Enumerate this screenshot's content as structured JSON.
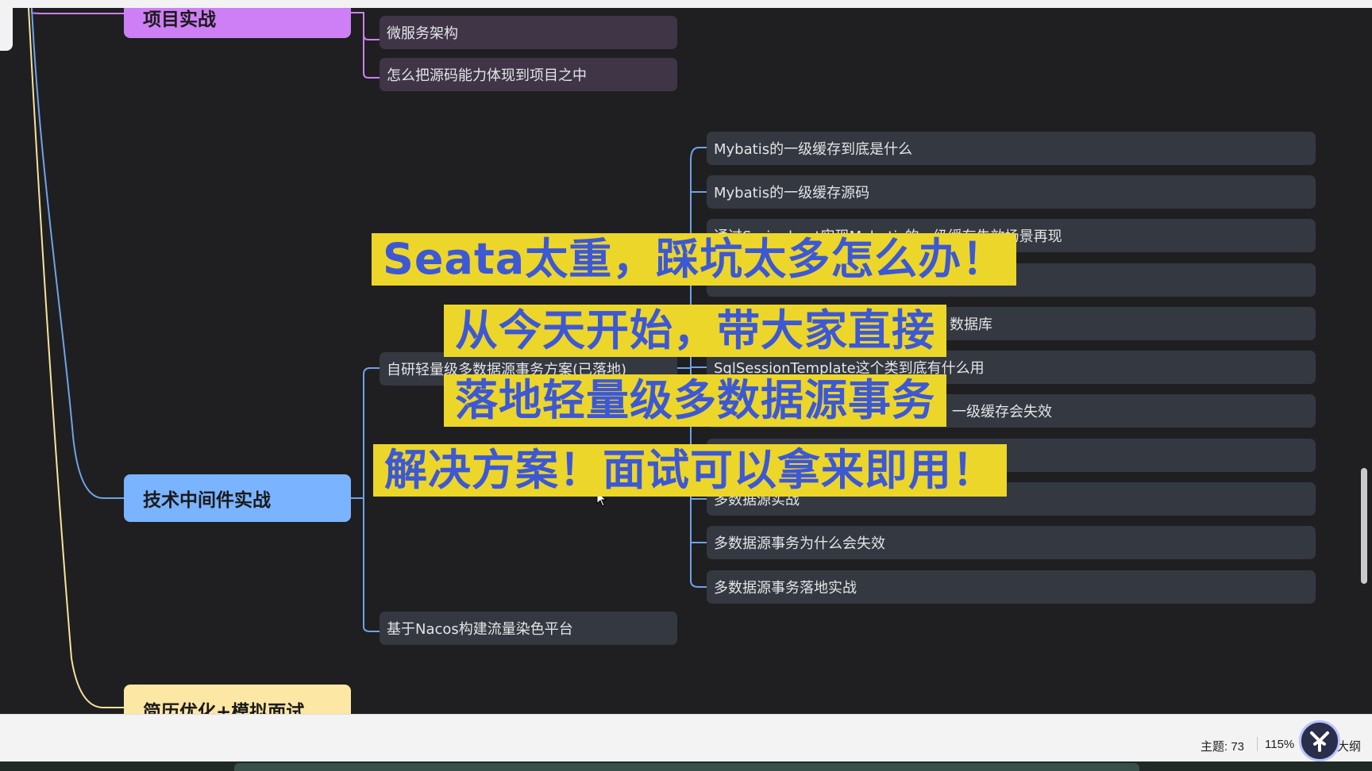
{
  "mindmap": {
    "topics": {
      "project": "项目实战",
      "middleware": "技术中间件实战",
      "resume": "简历优化+模拟面试"
    },
    "project_children": [
      "微服务架构",
      "怎么把源码能力体现到项目之中"
    ],
    "middleware_children": [
      "自研轻量级多数据源事务方案(已落地)",
      "基于Nacos构建流量染色平台"
    ],
    "subtopics": [
      "Mybatis的一级缓存到底是什么",
      "Mybatis的一级缓存源码",
      "通过Springboot实现Mybatis的一级缓存失效场景再现",
      "",
      "数据库",
      "SqlSessionTemplate这个类到底有什么用",
      "一级缓存会失效",
      "",
      "多数据源实战",
      "多数据源事务为什么会失效",
      "多数据源事务落地实战"
    ]
  },
  "overlay": {
    "line1": "Seata太重，踩坑太多怎么办！",
    "line2": "从今天开始，带大家直接",
    "line3": "落地轻量级多数据源事务",
    "line4": "解决方案！面试可以拿来即用！"
  },
  "statusbar": {
    "topic_count": "主题: 73",
    "zoom": "115%",
    "outline_label": "大纲"
  },
  "colors": {
    "background": "#1f1f21",
    "project_topic": "#cf7ff5",
    "middleware_topic": "#7ab3ff",
    "resume_topic": "#fde7a5",
    "overlay_highlight": "#ecd62a",
    "overlay_text": "#3d58d4"
  },
  "icons": {
    "logo": "app-logo-icon",
    "cursor": "mouse-cursor-icon"
  }
}
